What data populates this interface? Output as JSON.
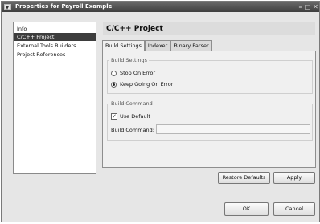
{
  "window": {
    "title": "Properties for Payroll Example"
  },
  "nav": {
    "items": [
      {
        "label": "Info"
      },
      {
        "label": "C/C++ Project",
        "selected": true
      },
      {
        "label": "External Tools Builders"
      },
      {
        "label": "Project References"
      }
    ]
  },
  "page": {
    "heading": "C/C++ Project"
  },
  "tabs": [
    {
      "label": "Build Settings",
      "active": true
    },
    {
      "label": "Indexer"
    },
    {
      "label": "Binary Parser"
    }
  ],
  "build_settings": {
    "group_title": "Build Settings",
    "stop_on_error": {
      "label": "Stop On Error",
      "selected": false
    },
    "keep_going": {
      "label": "Keep Going On Error",
      "selected": true
    }
  },
  "build_command": {
    "group_title": "Build Command",
    "use_default": {
      "label": "Use Default",
      "checked": true
    },
    "field_label": "Build Command:",
    "value": ""
  },
  "buttons": {
    "restore_defaults": "Restore Defaults",
    "apply": "Apply",
    "ok": "OK",
    "cancel": "Cancel"
  }
}
